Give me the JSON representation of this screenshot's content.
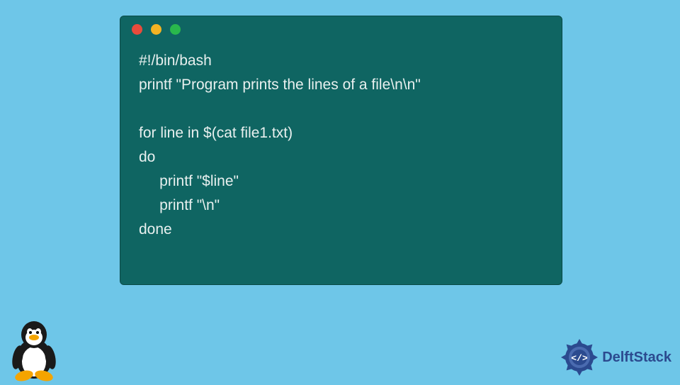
{
  "window": {
    "dots": [
      "red",
      "yellow",
      "green"
    ]
  },
  "code": {
    "line1": "#!/bin/bash",
    "line2": "printf \"Program prints the lines of a file\\n\\n\"",
    "line3": "",
    "line4": "for line in $(cat file1.txt)",
    "line5": "do",
    "line6": "     printf \"$line\"",
    "line7": "     printf \"\\n\"",
    "line8": "done"
  },
  "brand": {
    "name": "DelftStack"
  },
  "colors": {
    "bg": "#6EC6E8",
    "window": "#0F6562",
    "text": "#E8F0EF",
    "brand": "#2B4A8F"
  }
}
